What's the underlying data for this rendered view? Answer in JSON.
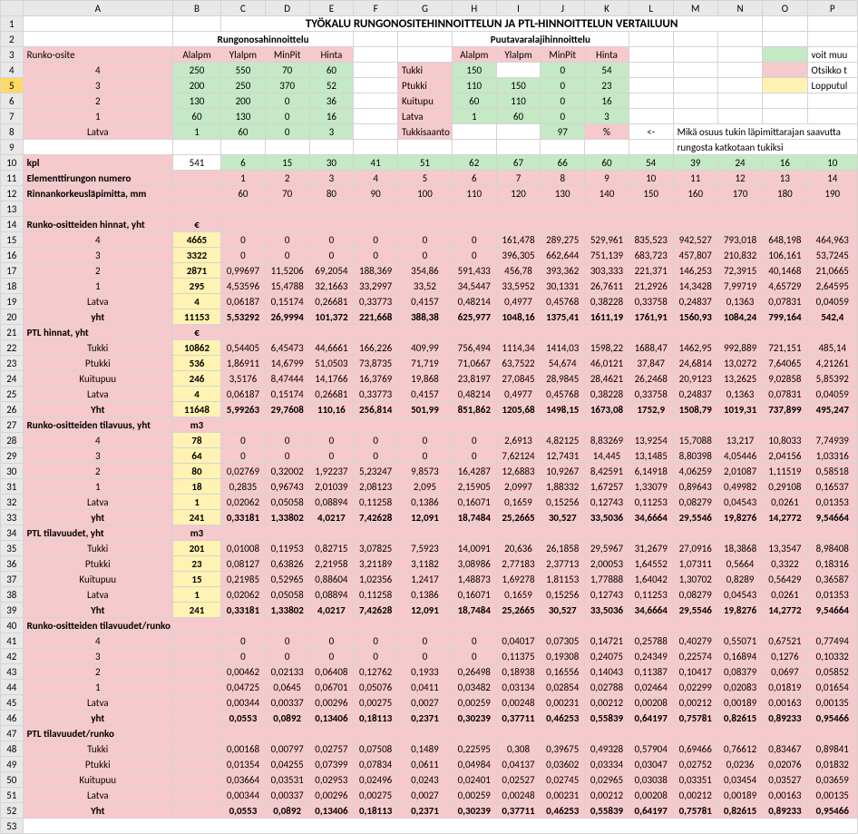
{
  "columns": [
    "",
    "A",
    "B",
    "C",
    "D",
    "E",
    "F",
    "G",
    "H",
    "I",
    "J",
    "K",
    "L",
    "M",
    "N",
    "O",
    "P"
  ],
  "title": "TYÖKALU RUNGONOSITEHINNOITTELUN JA PTL-HINNOITTELUN VERTAILUUN",
  "section_left": "Rungonosahinnoittelu",
  "section_right": "Puutavaralajihinnoittelu",
  "hdr": {
    "alalpm": "Alalpm",
    "ylalpm": "Ylalpm",
    "minpit": "MinPit",
    "hinta": "Hinta"
  },
  "side_notes": {
    "voit": "voit muu",
    "otsikko": "Otsikko t",
    "lopput": "Lopputul"
  },
  "runko_label": "Runko-osite",
  "left_rows": [
    {
      "name": "4",
      "a": "250",
      "b": "550",
      "c": "70",
      "d": "60"
    },
    {
      "name": "3",
      "a": "200",
      "b": "250",
      "c": "370",
      "d": "52"
    },
    {
      "name": "2",
      "a": "130",
      "b": "200",
      "c": "0",
      "d": "36"
    },
    {
      "name": "1",
      "a": "60",
      "b": "130",
      "c": "0",
      "d": "16"
    },
    {
      "name": "Latva",
      "a": "1",
      "b": "60",
      "c": "0",
      "d": "3"
    }
  ],
  "right_rows": [
    {
      "name": "Tukki",
      "a": "150",
      "b": "",
      "c": "0",
      "d": "54"
    },
    {
      "name": "Ptukki",
      "a": "110",
      "b": "150",
      "c": "0",
      "d": "23"
    },
    {
      "name": "Kuitupu",
      "a": "60",
      "b": "110",
      "c": "0",
      "d": "16"
    },
    {
      "name": "Latva",
      "a": "1",
      "b": "60",
      "c": "0",
      "d": "3"
    }
  ],
  "tukkis_label": "Tukkisaanto",
  "tukkis_val": "97",
  "percent": "%",
  "arrow": "<-",
  "tukkis_note1": "Mikä osuus tukin läpimittarajan saavutta",
  "tukkis_note2": "rungosta katkotaan tukiksi",
  "kpl": "kpl",
  "kpl_val": "541",
  "kpl_cols": [
    "6",
    "15",
    "30",
    "41",
    "51",
    "62",
    "67",
    "66",
    "60",
    "54",
    "39",
    "24",
    "16",
    "10"
  ],
  "elem_label": "Elementtirungon numero",
  "elem_cols": [
    "1",
    "2",
    "3",
    "4",
    "5",
    "6",
    "7",
    "8",
    "9",
    "10",
    "11",
    "12",
    "13",
    "14"
  ],
  "rinn_label": "Rinnankorkeusläpimitta, mm",
  "rinn_cols": [
    "60",
    "70",
    "80",
    "90",
    "100",
    "110",
    "120",
    "130",
    "140",
    "150",
    "160",
    "170",
    "180",
    "190"
  ],
  "sec_ro_hinnat": "Runko-ositteiden hinnat, yht",
  "euro": "€",
  "ro_h": [
    {
      "n": "4",
      "b": "4665",
      "v": [
        "0",
        "0",
        "0",
        "0",
        "0",
        "0",
        "161,478",
        "289,275",
        "529,961",
        "835,523",
        "942,527",
        "793,018",
        "648,198",
        "464,963"
      ]
    },
    {
      "n": "3",
      "b": "3322",
      "v": [
        "0",
        "0",
        "0",
        "0",
        "0",
        "0",
        "396,305",
        "662,644",
        "751,139",
        "683,723",
        "457,807",
        "210,832",
        "106,161",
        "53,7245"
      ]
    },
    {
      "n": "2",
      "b": "2871",
      "v": [
        "0,99697",
        "11,5206",
        "69,2054",
        "188,369",
        "354,86",
        "591,433",
        "456,78",
        "393,362",
        "303,333",
        "221,371",
        "146,253",
        "72,3915",
        "40,1468",
        "21,0665"
      ]
    },
    {
      "n": "1",
      "b": "295",
      "v": [
        "4,53596",
        "15,4788",
        "32,1663",
        "33,2997",
        "33,52",
        "34,5447",
        "33,5952",
        "30,1331",
        "26,7611",
        "21,2926",
        "14,3428",
        "7,99719",
        "4,65729",
        "2,64595"
      ]
    },
    {
      "n": "Latva",
      "b": "4",
      "v": [
        "0,06187",
        "0,15174",
        "0,26681",
        "0,33773",
        "0,4157",
        "0,48214",
        "0,4977",
        "0,45768",
        "0,38228",
        "0,33758",
        "0,24837",
        "0,1363",
        "0,07831",
        "0,04059"
      ]
    },
    {
      "n": "yht",
      "b": "11153",
      "v": [
        "5,53292",
        "26,9994",
        "101,372",
        "221,668",
        "388,38",
        "625,977",
        "1048,16",
        "1375,41",
        "1611,19",
        "1761,91",
        "1560,93",
        "1084,24",
        "799,164",
        "542,4"
      ],
      "bold": true
    }
  ],
  "sec_ptl_hinnat": "PTL hinnat, yht",
  "ptl_h": [
    {
      "n": "Tukki",
      "b": "10862",
      "v": [
        "0,54405",
        "6,45473",
        "44,6661",
        "166,226",
        "409,99",
        "756,494",
        "1114,34",
        "1414,03",
        "1598,22",
        "1688,47",
        "1462,95",
        "992,889",
        "721,151",
        "485,14"
      ]
    },
    {
      "n": "Ptukki",
      "b": "536",
      "v": [
        "1,86911",
        "14,6799",
        "51,0503",
        "73,8735",
        "71,719",
        "71,0667",
        "63,7522",
        "54,674",
        "46,0121",
        "37,847",
        "24,6814",
        "13,0272",
        "7,64065",
        "4,21261"
      ]
    },
    {
      "n": "Kuitupuu",
      "b": "246",
      "v": [
        "3,5176",
        "8,47444",
        "14,1766",
        "16,3769",
        "19,868",
        "23,8197",
        "27,0845",
        "28,9845",
        "28,4621",
        "26,2468",
        "20,9123",
        "13,2625",
        "9,02858",
        "5,85392"
      ]
    },
    {
      "n": "Latva",
      "b": "4",
      "v": [
        "0,06187",
        "0,15174",
        "0,26681",
        "0,33773",
        "0,4157",
        "0,48214",
        "0,4977",
        "0,45768",
        "0,38228",
        "0,33758",
        "0,24837",
        "0,1363",
        "0,07831",
        "0,04059"
      ]
    },
    {
      "n": "Yht",
      "b": "11648",
      "v": [
        "5,99263",
        "29,7608",
        "110,16",
        "256,814",
        "501,99",
        "851,862",
        "1205,68",
        "1498,15",
        "1673,08",
        "1752,9",
        "1508,79",
        "1019,31",
        "737,899",
        "495,247"
      ],
      "bold": true
    }
  ],
  "sec_ro_til": "Runko-ositteiden tilavuus, yht",
  "m3": "m3",
  "ro_t": [
    {
      "n": "4",
      "b": "78",
      "v": [
        "0",
        "0",
        "0",
        "0",
        "0",
        "0",
        "2,6913",
        "4,82125",
        "8,83269",
        "13,9254",
        "15,7088",
        "13,217",
        "10,8033",
        "7,74939"
      ]
    },
    {
      "n": "3",
      "b": "64",
      "v": [
        "0",
        "0",
        "0",
        "0",
        "0",
        "0",
        "7,62124",
        "12,7431",
        "14,445",
        "13,1485",
        "8,80398",
        "4,05446",
        "2,04156",
        "1,03316"
      ]
    },
    {
      "n": "2",
      "b": "80",
      "v": [
        "0,02769",
        "0,32002",
        "1,92237",
        "5,23247",
        "9,8573",
        "16,4287",
        "12,6883",
        "10,9267",
        "8,42591",
        "6,14918",
        "4,06259",
        "2,01087",
        "1,11519",
        "0,58518"
      ]
    },
    {
      "n": "1",
      "b": "18",
      "v": [
        "0,2835",
        "0,96743",
        "2,01039",
        "2,08123",
        "2,095",
        "2,15905",
        "2,0997",
        "1,88332",
        "1,67257",
        "1,33079",
        "0,89643",
        "0,49982",
        "0,29108",
        "0,16537"
      ]
    },
    {
      "n": "Latva",
      "b": "1",
      "v": [
        "0,02062",
        "0,05058",
        "0,08894",
        "0,11258",
        "0,1386",
        "0,16071",
        "0,1659",
        "0,15256",
        "0,12743",
        "0,11253",
        "0,08279",
        "0,04543",
        "0,0261",
        "0,01353"
      ]
    },
    {
      "n": "yht",
      "b": "241",
      "v": [
        "0,33181",
        "1,33802",
        "4,0217",
        "7,42628",
        "12,091",
        "18,7484",
        "25,2665",
        "30,527",
        "33,5036",
        "34,6664",
        "29,5546",
        "19,8276",
        "14,2772",
        "9,54664"
      ],
      "bold": true
    }
  ],
  "sec_ptl_til": "PTL tilavuudet, yht",
  "ptl_t": [
    {
      "n": "Tukki",
      "b": "201",
      "v": [
        "0,01008",
        "0,11953",
        "0,82715",
        "3,07825",
        "7,5923",
        "14,0091",
        "20,636",
        "26,1858",
        "29,5967",
        "31,2679",
        "27,0916",
        "18,3868",
        "13,3547",
        "8,98408"
      ]
    },
    {
      "n": "Ptukki",
      "b": "23",
      "v": [
        "0,08127",
        "0,63826",
        "2,21958",
        "3,21189",
        "3,1182",
        "3,08986",
        "2,77183",
        "2,37713",
        "2,00053",
        "1,64552",
        "1,07311",
        "0,5664",
        "0,3322",
        "0,18316"
      ]
    },
    {
      "n": "Kuitupuu",
      "b": "15",
      "v": [
        "0,21985",
        "0,52965",
        "0,88604",
        "1,02356",
        "1,2417",
        "1,48873",
        "1,69278",
        "1,81153",
        "1,77888",
        "1,64042",
        "1,30702",
        "0,8289",
        "0,56429",
        "0,36587"
      ]
    },
    {
      "n": "Latva",
      "b": "1",
      "v": [
        "0,02062",
        "0,05058",
        "0,08894",
        "0,11258",
        "0,1386",
        "0,16071",
        "0,1659",
        "0,15256",
        "0,12743",
        "0,11253",
        "0,08279",
        "0,04543",
        "0,0261",
        "0,01353"
      ]
    },
    {
      "n": "Yht",
      "b": "241",
      "v": [
        "0,33181",
        "1,33802",
        "4,0217",
        "7,42628",
        "12,091",
        "18,7484",
        "25,2665",
        "30,527",
        "33,5036",
        "34,6664",
        "29,5546",
        "19,8276",
        "14,2772",
        "9,54664"
      ],
      "bold": true
    }
  ],
  "sec_ro_tr": "Runko-ositteiden tilavuudet/runko",
  "ro_tr": [
    {
      "n": "4",
      "v": [
        "0",
        "0",
        "0",
        "0",
        "0",
        "0",
        "0,04017",
        "0,07305",
        "0,14721",
        "0,25788",
        "0,40279",
        "0,55071",
        "0,67521",
        "0,77494"
      ]
    },
    {
      "n": "3",
      "v": [
        "0",
        "0",
        "0",
        "0",
        "0",
        "0",
        "0,11375",
        "0,19308",
        "0,24075",
        "0,24349",
        "0,22574",
        "0,16894",
        "0,1276",
        "0,10332"
      ]
    },
    {
      "n": "2",
      "v": [
        "0,00462",
        "0,02133",
        "0,06408",
        "0,12762",
        "0,1933",
        "0,26498",
        "0,18938",
        "0,16556",
        "0,14043",
        "0,11387",
        "0,10417",
        "0,08379",
        "0,0697",
        "0,05852"
      ]
    },
    {
      "n": "1",
      "v": [
        "0,04725",
        "0,0645",
        "0,06701",
        "0,05076",
        "0,0411",
        "0,03482",
        "0,03134",
        "0,02854",
        "0,02788",
        "0,02464",
        "0,02299",
        "0,02083",
        "0,01819",
        "0,01654"
      ]
    },
    {
      "n": "Latva",
      "v": [
        "0,00344",
        "0,00337",
        "0,00296",
        "0,00275",
        "0,0027",
        "0,00259",
        "0,00248",
        "0,00231",
        "0,00212",
        "0,00208",
        "0,00212",
        "0,00189",
        "0,00163",
        "0,00135"
      ]
    },
    {
      "n": "yht",
      "v": [
        "0,0553",
        "0,0892",
        "0,13406",
        "0,18113",
        "0,2371",
        "0,30239",
        "0,37711",
        "0,46253",
        "0,55839",
        "0,64197",
        "0,75781",
        "0,82615",
        "0,89233",
        "0,95466"
      ],
      "bold": true
    }
  ],
  "sec_ptl_tr": "PTL tilavuudet/runko",
  "ptl_tr": [
    {
      "n": "Tukki",
      "v": [
        "0,00168",
        "0,00797",
        "0,02757",
        "0,07508",
        "0,1489",
        "0,22595",
        "0,308",
        "0,39675",
        "0,49328",
        "0,57904",
        "0,69466",
        "0,76612",
        "0,83467",
        "0,89841"
      ]
    },
    {
      "n": "Ptukki",
      "v": [
        "0,01354",
        "0,04255",
        "0,07399",
        "0,07834",
        "0,0611",
        "0,04984",
        "0,04137",
        "0,03602",
        "0,03334",
        "0,03047",
        "0,02752",
        "0,0236",
        "0,02076",
        "0,01832"
      ]
    },
    {
      "n": "Kuitupuu",
      "v": [
        "0,03664",
        "0,03531",
        "0,02953",
        "0,02496",
        "0,0243",
        "0,02401",
        "0,02527",
        "0,02745",
        "0,02965",
        "0,03038",
        "0,03351",
        "0,03454",
        "0,03527",
        "0,03659"
      ]
    },
    {
      "n": "Latva",
      "v": [
        "0,00344",
        "0,00337",
        "0,00296",
        "0,00275",
        "0,0027",
        "0,00259",
        "0,00248",
        "0,00231",
        "0,00212",
        "0,00208",
        "0,00212",
        "0,00189",
        "0,00163",
        "0,00135"
      ]
    },
    {
      "n": "Yht",
      "v": [
        "0,0553",
        "0,0892",
        "0,13406",
        "0,18113",
        "0,2371",
        "0,30239",
        "0,37711",
        "0,46253",
        "0,55839",
        "0,64197",
        "0,75781",
        "0,82615",
        "0,89233",
        "0,95466"
      ],
      "bold": true
    }
  ]
}
